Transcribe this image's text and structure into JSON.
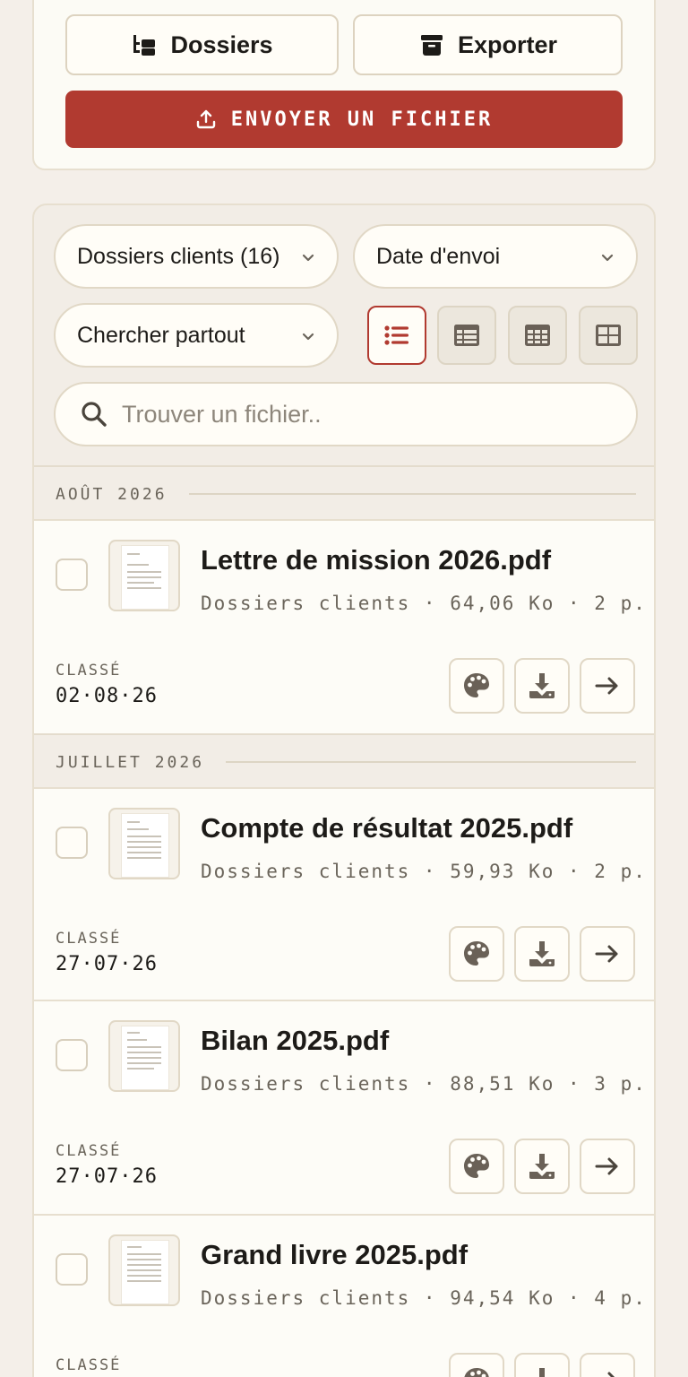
{
  "toolbar": {
    "folders_label": "Dossiers",
    "export_label": "Exporter",
    "upload_label": "ENVOYER UN FICHIER"
  },
  "filters": {
    "folder_select": "Dossiers clients (16)",
    "sort_select": "Date d'envoi",
    "scope_select": "Chercher partout",
    "view_modes": [
      "list-icon",
      "table-icon",
      "grid-small-icon",
      "grid-large-icon"
    ],
    "active_view": "list",
    "search_placeholder": "Trouver un fichier.."
  },
  "groups": [
    {
      "month": "AOÛT 2026"
    },
    {
      "month": "JUILLET 2026"
    }
  ],
  "files": [
    {
      "name": "Lettre de mission 2026.pdf",
      "meta": "Dossiers clients · 64,06 Ko · 2 p.",
      "status": "CLASSÉ",
      "date": "02·08·26"
    },
    {
      "name": "Compte de résultat 2025.pdf",
      "meta": "Dossiers clients · 59,93 Ko · 2 p.",
      "status": "CLASSÉ",
      "date": "27·07·26"
    },
    {
      "name": "Bilan 2025.pdf",
      "meta": "Dossiers clients · 88,51 Ko · 3 p.",
      "status": "CLASSÉ",
      "date": "27·07·26"
    },
    {
      "name": "Grand livre 2025.pdf",
      "meta": "Dossiers clients · 94,54 Ko · 4 p.",
      "status": "CLASSÉ",
      "date": ""
    }
  ],
  "row_actions": [
    "palette-icon",
    "download-icon",
    "arrow-right-icon"
  ],
  "colors": {
    "accent": "#b13a30",
    "background": "#f4efe9",
    "card": "#fdfcf7",
    "border": "#e1d8c6",
    "icon": "#6a6157"
  }
}
